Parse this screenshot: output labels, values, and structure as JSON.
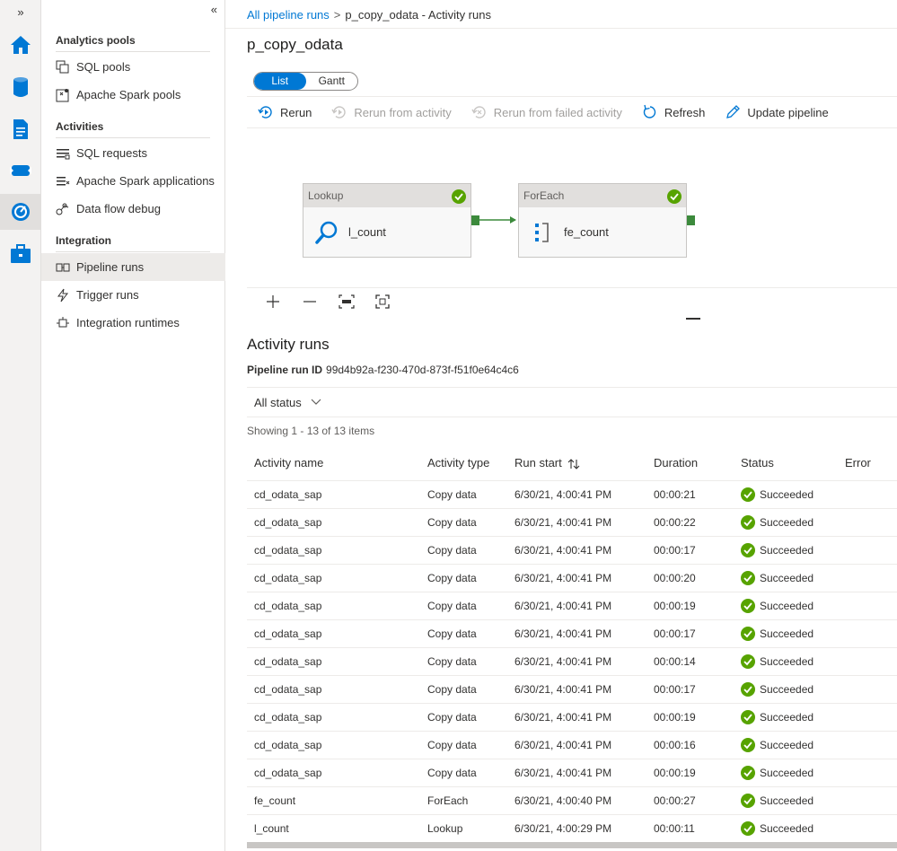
{
  "rail": {
    "expand_glyph": "»",
    "items": [
      {
        "icon": "home-icon"
      },
      {
        "icon": "data-icon"
      },
      {
        "icon": "develop-icon"
      },
      {
        "icon": "integrate-icon"
      },
      {
        "icon": "monitor-icon"
      },
      {
        "icon": "manage-icon"
      }
    ]
  },
  "sidebar": {
    "collapse_glyph": "«",
    "sections": [
      {
        "title": "Analytics pools",
        "items": [
          {
            "label": "SQL pools",
            "icon": "sql-pools-icon"
          },
          {
            "label": "Apache Spark pools",
            "icon": "spark-pools-icon"
          }
        ]
      },
      {
        "title": "Activities",
        "items": [
          {
            "label": "SQL requests",
            "icon": "sql-requests-icon"
          },
          {
            "label": "Apache Spark applications",
            "icon": "spark-applications-icon"
          },
          {
            "label": "Data flow debug",
            "icon": "data-flow-debug-icon"
          }
        ]
      },
      {
        "title": "Integration",
        "items": [
          {
            "label": "Pipeline runs",
            "icon": "pipeline-runs-icon",
            "selected": true
          },
          {
            "label": "Trigger runs",
            "icon": "trigger-runs-icon"
          },
          {
            "label": "Integration runtimes",
            "icon": "integration-runtimes-icon"
          }
        ]
      }
    ]
  },
  "breadcrumb": {
    "link": "All pipeline runs",
    "separator": ">",
    "current": "p_copy_odata - Activity runs"
  },
  "page_title": "p_copy_odata",
  "view_toggle": {
    "list": "List",
    "gantt": "Gantt",
    "selected": "List"
  },
  "toolbar": {
    "rerun": "Rerun",
    "rerun_from_activity": "Rerun from activity",
    "rerun_from_failed": "Rerun from failed activity",
    "refresh": "Refresh",
    "update_pipeline": "Update pipeline"
  },
  "pipeline_canvas": {
    "nodes": [
      {
        "type": "Lookup",
        "name": "l_count",
        "icon": "lookup-icon",
        "status_icon": "success-check-icon"
      },
      {
        "type": "ForEach",
        "name": "fe_count",
        "icon": "foreach-icon",
        "status_icon": "success-check-icon"
      }
    ]
  },
  "activity_runs": {
    "title": "Activity runs",
    "pipeline_run_id_label": "Pipeline run ID",
    "pipeline_run_id": "99d4b92a-f230-470d-873f-f51f0e64c4c6",
    "status_filter": "All status",
    "showing": "Showing 1 - 13 of 13 items",
    "columns": [
      "Activity name",
      "Activity type",
      "Run start",
      "Duration",
      "Status",
      "Error"
    ],
    "rows": [
      {
        "name": "cd_odata_sap",
        "type": "Copy data",
        "start": "6/30/21, 4:00:41 PM",
        "duration": "00:00:21",
        "status": "Succeeded",
        "error": ""
      },
      {
        "name": "cd_odata_sap",
        "type": "Copy data",
        "start": "6/30/21, 4:00:41 PM",
        "duration": "00:00:22",
        "status": "Succeeded",
        "error": ""
      },
      {
        "name": "cd_odata_sap",
        "type": "Copy data",
        "start": "6/30/21, 4:00:41 PM",
        "duration": "00:00:17",
        "status": "Succeeded",
        "error": ""
      },
      {
        "name": "cd_odata_sap",
        "type": "Copy data",
        "start": "6/30/21, 4:00:41 PM",
        "duration": "00:00:20",
        "status": "Succeeded",
        "error": ""
      },
      {
        "name": "cd_odata_sap",
        "type": "Copy data",
        "start": "6/30/21, 4:00:41 PM",
        "duration": "00:00:19",
        "status": "Succeeded",
        "error": ""
      },
      {
        "name": "cd_odata_sap",
        "type": "Copy data",
        "start": "6/30/21, 4:00:41 PM",
        "duration": "00:00:17",
        "status": "Succeeded",
        "error": ""
      },
      {
        "name": "cd_odata_sap",
        "type": "Copy data",
        "start": "6/30/21, 4:00:41 PM",
        "duration": "00:00:14",
        "status": "Succeeded",
        "error": ""
      },
      {
        "name": "cd_odata_sap",
        "type": "Copy data",
        "start": "6/30/21, 4:00:41 PM",
        "duration": "00:00:17",
        "status": "Succeeded",
        "error": ""
      },
      {
        "name": "cd_odata_sap",
        "type": "Copy data",
        "start": "6/30/21, 4:00:41 PM",
        "duration": "00:00:19",
        "status": "Succeeded",
        "error": ""
      },
      {
        "name": "cd_odata_sap",
        "type": "Copy data",
        "start": "6/30/21, 4:00:41 PM",
        "duration": "00:00:16",
        "status": "Succeeded",
        "error": ""
      },
      {
        "name": "cd_odata_sap",
        "type": "Copy data",
        "start": "6/30/21, 4:00:41 PM",
        "duration": "00:00:19",
        "status": "Succeeded",
        "error": ""
      },
      {
        "name": "fe_count",
        "type": "ForEach",
        "start": "6/30/21, 4:00:40 PM",
        "duration": "00:00:27",
        "status": "Succeeded",
        "error": ""
      },
      {
        "name": "l_count",
        "type": "Lookup",
        "start": "6/30/21, 4:00:29 PM",
        "duration": "00:00:11",
        "status": "Succeeded",
        "error": ""
      }
    ]
  },
  "colors": {
    "accent": "#0078d4",
    "success": "#57a300",
    "connector": "#3c8a3c"
  }
}
